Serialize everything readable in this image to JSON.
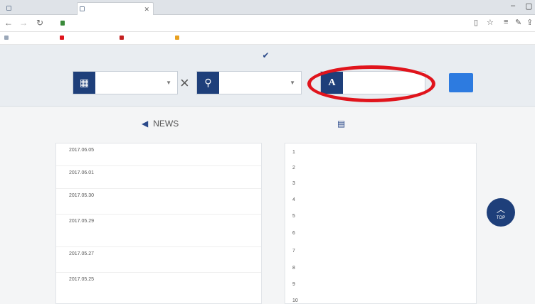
{
  "browser": {
    "tabs": [
      {
        "title": ""
      },
      {
        "title": ""
      }
    ],
    "address": "",
    "bookmarks": [
      "",
      "",
      "",
      ""
    ]
  },
  "search": {
    "title": "",
    "category_value": "",
    "region_value": "",
    "keyword_value": "",
    "button_label": ""
  },
  "news": {
    "heading": "NEWS",
    "items": [
      {
        "date": "2017.06.05",
        "title": ""
      },
      {
        "date": "2017.06.01",
        "title": ""
      },
      {
        "date": "2017.05.30",
        "title": ""
      },
      {
        "date": "2017.05.29",
        "title": ""
      },
      {
        "date": "2017.05.27",
        "title": ""
      },
      {
        "date": "2017.05.25",
        "title": ""
      }
    ]
  },
  "datasets": {
    "heading": "",
    "items": [
      {
        "rank": "1",
        "title": ""
      },
      {
        "rank": "2",
        "title": ""
      },
      {
        "rank": "3",
        "title": ""
      },
      {
        "rank": "4",
        "title": ""
      },
      {
        "rank": "5",
        "title": ""
      },
      {
        "rank": "6",
        "title": ""
      },
      {
        "rank": "7",
        "title": ""
      },
      {
        "rank": "8",
        "title": ""
      },
      {
        "rank": "9",
        "title": ""
      },
      {
        "rank": "10",
        "title": ""
      }
    ]
  },
  "page_top": {
    "label": "TOP"
  },
  "colors": {
    "navy": "#1e3f7a",
    "search_button": "#2d7be0",
    "link": "#2a55b5",
    "highlight": "#e0141c"
  }
}
